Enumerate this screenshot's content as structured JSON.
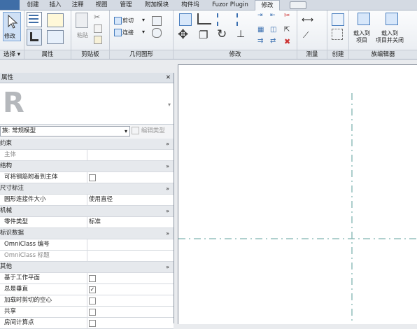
{
  "tabs": [
    {
      "label": "创建"
    },
    {
      "label": "插入"
    },
    {
      "label": "注释"
    },
    {
      "label": "视图"
    },
    {
      "label": "管理"
    },
    {
      "label": "附加模块"
    },
    {
      "label": "构件坞"
    },
    {
      "label": "Fuzor Plugin"
    },
    {
      "label": "修改",
      "active": true
    }
  ],
  "ribbon": {
    "modify_label": "修改",
    "panels": [
      "选择 ▾",
      "属性",
      "剪贴板",
      "几何图形",
      "修改",
      "测量",
      "创建",
      "族编辑器"
    ],
    "paste": "粘贴",
    "cut": "剪切",
    "join": "连接",
    "load1": "载入到\n项目",
    "load2": "载入到\n项目并关闭"
  },
  "properties": {
    "title": "属性",
    "close": "✕",
    "type_name": "族: 常规模型",
    "edit_type": "编辑类型",
    "rows": [
      {
        "type": "cat",
        "label": "约束",
        "chev": "»"
      },
      {
        "type": "row",
        "label": "主体",
        "value": "",
        "gray": true
      },
      {
        "type": "cat",
        "label": "结构",
        "chev": "»"
      },
      {
        "type": "row",
        "label": "可将钢筋附着到主体",
        "checkbox": true,
        "checked": false
      },
      {
        "type": "cat",
        "label": "尺寸标注",
        "chev": "»"
      },
      {
        "type": "row",
        "label": "圆形连接件大小",
        "value": "使用直径"
      },
      {
        "type": "cat",
        "label": "机械",
        "chev": "»"
      },
      {
        "type": "row",
        "label": "零件类型",
        "value": "标准"
      },
      {
        "type": "cat",
        "label": "标识数据",
        "chev": "»"
      },
      {
        "type": "row",
        "label": "OmniClass 编号",
        "value": ""
      },
      {
        "type": "row",
        "label": "OmniClass 标题",
        "value": "",
        "gray": true
      },
      {
        "type": "cat",
        "label": "其他",
        "chev": "»"
      },
      {
        "type": "row",
        "label": "基于工作平面",
        "checkbox": true,
        "checked": false
      },
      {
        "type": "row",
        "label": "总是垂直",
        "checkbox": true,
        "checked": true
      },
      {
        "type": "row",
        "label": "加载时剪切的空心",
        "checkbox": true,
        "checked": false
      },
      {
        "type": "row",
        "label": "共享",
        "checkbox": true,
        "checked": false
      },
      {
        "type": "row",
        "label": "房间计算点",
        "checkbox": true,
        "checked": false
      }
    ]
  },
  "colors": {
    "accent": "#3f6ea7",
    "refline": "#7fb3b0"
  }
}
